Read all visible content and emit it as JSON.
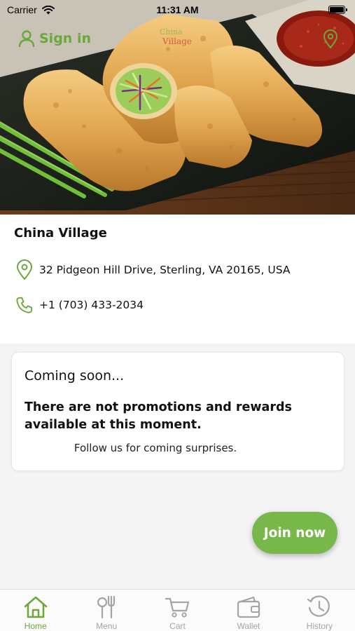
{
  "status_bar": {
    "carrier": "Carrier",
    "time": "11:31 AM",
    "battery_level": 1.0
  },
  "header": {
    "sign_in_label": "Sign in",
    "sign_in_icon": "user-icon",
    "logo_text_top": "China",
    "logo_text_bottom": "Village",
    "location_icon": "map-pin-icon"
  },
  "store": {
    "name": "China Village",
    "address": "32 Pidgeon Hill Drive, Sterling, VA 20165, USA",
    "address_icon": "map-pin-icon",
    "phone": "+1 (703) 433-2034",
    "phone_icon": "phone-icon"
  },
  "promo": {
    "title": "Coming soon...",
    "message": "There are not promotions and rewards available at this moment.",
    "follow": "Follow us for coming surprises."
  },
  "join_button": "Join now",
  "tabs": [
    {
      "label": "Home",
      "icon": "home-icon",
      "active": true
    },
    {
      "label": "Menu",
      "icon": "fork-knife-icon",
      "active": false
    },
    {
      "label": "Cart",
      "icon": "cart-icon",
      "active": false
    },
    {
      "label": "Wallet",
      "icon": "wallet-icon",
      "active": false
    },
    {
      "label": "History",
      "icon": "history-icon",
      "active": false
    }
  ],
  "colors": {
    "accent": "#6aa83a",
    "join_button": "#78b84a",
    "tab_inactive": "#a4a4a4"
  }
}
